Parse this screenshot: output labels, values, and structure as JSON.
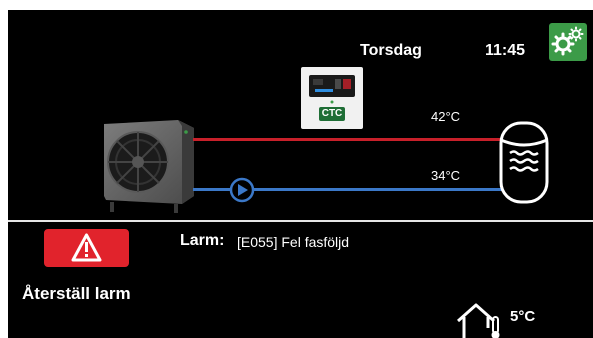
{
  "header": {
    "day": "Torsdag",
    "time": "11:45"
  },
  "system": {
    "supply_temp": "42°C",
    "return_temp": "34°C",
    "controller_logo": "CTC"
  },
  "alarm": {
    "label": "Larm:",
    "message": "[E055] Fel fasföljd",
    "reset_label": "Återställ larm"
  },
  "outdoor": {
    "temp": "5°C"
  },
  "colors": {
    "hot_pipe": "#c8202a",
    "cold_pipe": "#3b78c8",
    "settings_green": "#3c9b48",
    "alarm_red": "#e1232c"
  },
  "icons": {
    "settings": "gears-icon",
    "pump": "pump-icon",
    "alarm": "warning-icon",
    "outdoor": "house-thermometer-icon"
  }
}
